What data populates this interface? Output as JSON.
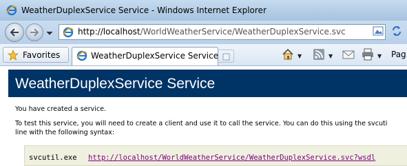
{
  "window": {
    "title": "WeatherDuplexService Service - Windows Internet Explorer"
  },
  "address_bar": {
    "url_host": "http://localhost",
    "url_path": "/WorldWeatherService/WeatherDuplexService.svc"
  },
  "favorites_bar": {
    "favorites_label": "Favorites",
    "tab_title": "WeatherDuplexService Service",
    "page_menu_label": "Pag"
  },
  "page": {
    "heading": "WeatherDuplexService Service",
    "paragraph1": "You have created a service.",
    "paragraph2_line1": "To test this service, you will need to create a client and use it to call the service. You can do this using the svcuti",
    "paragraph2_line2": "line with the following syntax:",
    "code_command": "svcutil.exe",
    "code_link": "http://localhost/WorldWeatherService/WeatherDuplexService.svc?wsdl"
  },
  "colors": {
    "heading_band": "#003366",
    "code_background": "#f0f0e0",
    "visited_link": "#800080"
  },
  "icons": [
    "ie-logo-icon",
    "back-arrow-icon",
    "forward-arrow-icon",
    "compatibility-view-icon",
    "refresh-icon",
    "favorites-star-icon",
    "new-tab-icon",
    "home-icon",
    "rss-feed-icon",
    "read-mail-icon",
    "print-icon",
    "chevron-down-icon"
  ]
}
